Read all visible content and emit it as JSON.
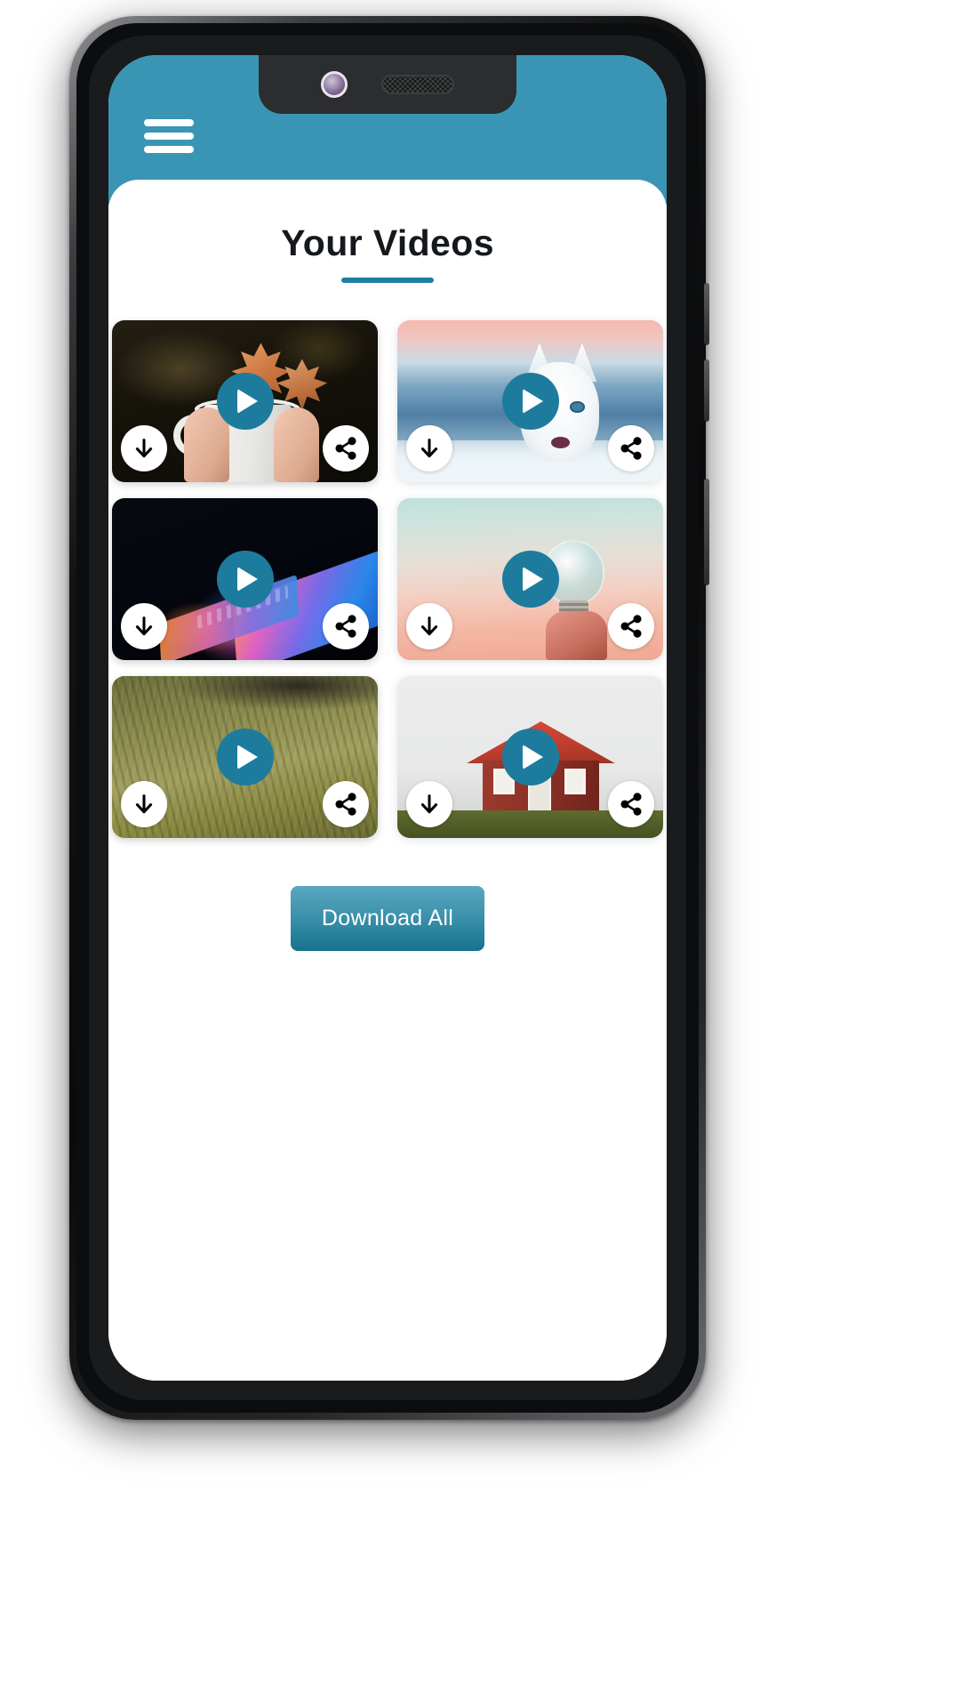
{
  "app": {
    "header": {
      "background_color": "#3a95b5",
      "menu_icon": "hamburger-menu-icon"
    },
    "title": "Your Videos",
    "accent_color": "#1f7fa0",
    "play_button_color": "#1d7c9d"
  },
  "device": {
    "camera_icon": "front-camera-icon",
    "speaker_icon": "earpiece-speaker-icon"
  },
  "videos": [
    {
      "id": "video-1",
      "scene": "autumn-leaves-in-white-mug",
      "play_label": "play-icon",
      "download_label": "download-icon",
      "share_label": "share-icon"
    },
    {
      "id": "video-2",
      "scene": "white-husky-dog-in-snow",
      "play_label": "play-icon",
      "download_label": "download-icon",
      "share_label": "share-icon"
    },
    {
      "id": "video-3",
      "scene": "laptop-with-colorful-gradient-screen",
      "play_label": "play-icon",
      "download_label": "download-icon",
      "share_label": "share-icon"
    },
    {
      "id": "video-4",
      "scene": "hand-holding-lightbulb-pastel-sky",
      "play_label": "play-icon",
      "download_label": "download-icon",
      "share_label": "share-icon"
    },
    {
      "id": "video-5",
      "scene": "green-grass-field",
      "play_label": "play-icon",
      "download_label": "download-icon",
      "share_label": "share-icon"
    },
    {
      "id": "video-6",
      "scene": "red-house-with-red-roof",
      "play_label": "play-icon",
      "download_label": "download-icon",
      "share_label": "share-icon"
    }
  ],
  "footer": {
    "download_all_label": "Download All"
  }
}
